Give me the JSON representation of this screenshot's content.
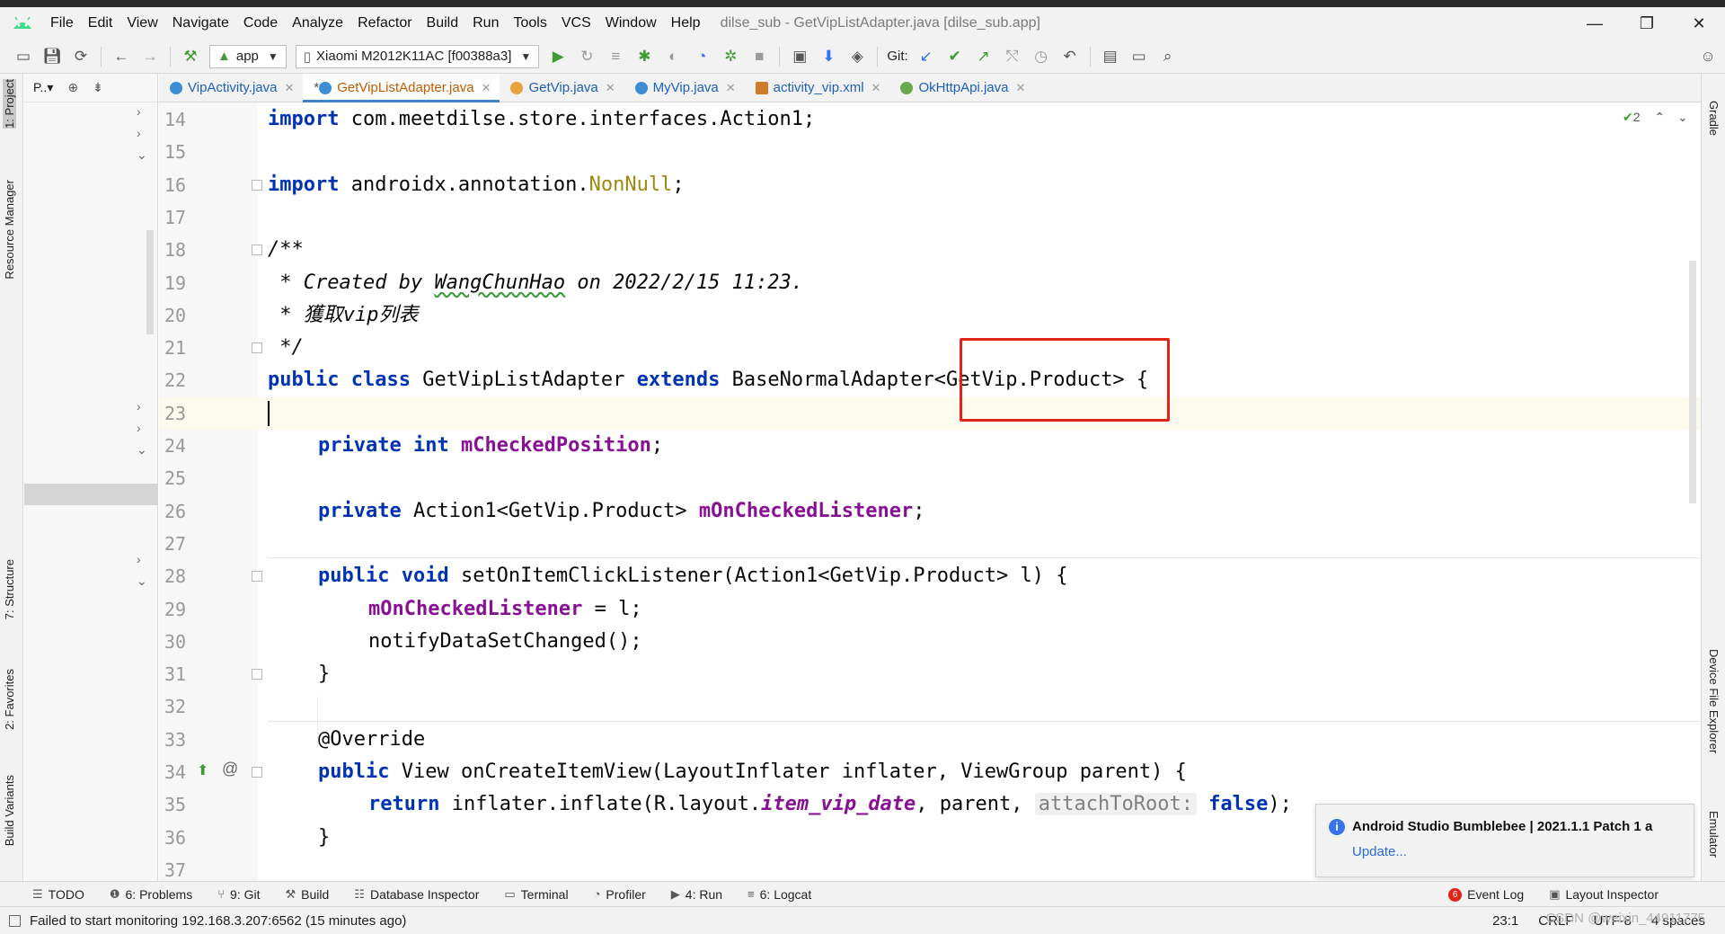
{
  "window": {
    "title": "dilse_sub - GetVipListAdapter.java [dilse_sub.app]",
    "controls": [
      "—",
      "❐",
      "✕"
    ]
  },
  "menu": [
    {
      "label": "File"
    },
    {
      "label": "Edit"
    },
    {
      "label": "View"
    },
    {
      "label": "Navigate"
    },
    {
      "label": "Code"
    },
    {
      "label": "Analyze"
    },
    {
      "label": "Refactor"
    },
    {
      "label": "Build"
    },
    {
      "label": "Run"
    },
    {
      "label": "Tools"
    },
    {
      "label": "VCS"
    },
    {
      "label": "Window"
    },
    {
      "label": "Help"
    }
  ],
  "toolbar": {
    "run_config": "app",
    "device": "Xiaomi M2012K11AC [f00388a3]",
    "git_label": "Git:"
  },
  "left_stripe": {
    "project": "1: Project",
    "resource_manager": "Resource Manager",
    "structure": "7: Structure",
    "favorites": "2: Favorites",
    "build_variants": "Build Variants"
  },
  "right_stripe": {
    "gradle": "Gradle",
    "device_file_explorer": "Device File Explorer",
    "emulator": "Emulator"
  },
  "project_panel": {
    "header": "P..▾"
  },
  "tabs": [
    {
      "label": "VipActivity.java",
      "color": "#3b8ed6"
    },
    {
      "label": "GetVipListAdapter.java",
      "color": "#3b8ed6",
      "modified": "*"
    },
    {
      "label": "GetVip.java",
      "color": "#e8a33d"
    },
    {
      "label": "MyVip.java",
      "color": "#3b8ed6"
    },
    {
      "label": "activity_vip.xml",
      "color": "#d07b2a"
    },
    {
      "label": "OkHttpApi.java",
      "color": "#6aa84f"
    }
  ],
  "editor": {
    "inspection_count": "2",
    "lines": {
      "n14": "14",
      "n15": "15",
      "n16": "16",
      "n17": "17",
      "n18": "18",
      "n19": "19",
      "n20": "20",
      "n21": "21",
      "n22": "22",
      "n23": "23",
      "n24": "24",
      "n25": "25",
      "n26": "26",
      "n27": "27",
      "n28": "28",
      "n29": "29",
      "n30": "30",
      "n31": "31",
      "n32": "32",
      "n33": "33",
      "n34": "34",
      "n35": "35",
      "n36": "36",
      "n37": "37"
    },
    "code": {
      "l14_kw": "import",
      "l14_rest": " com.meetdilse.store.interfaces.Action1;",
      "l16_kw": "import",
      "l16_pkg": " androidx.annotation.",
      "l16_ann": "NonNull",
      "l16_end": ";",
      "l18": "/**",
      "l19_a": " * Created by ",
      "l19_name": "WangChunHao",
      "l19_b": " on 2022/2/15 11:23.",
      "l20": " * 獲取vip列表",
      "l21": " */",
      "l22_kw1": "public class",
      "l22_name": " GetVipListAdapter ",
      "l22_kw2": "extends",
      "l22_rest": " BaseNormalAdapter<GetVip.Product> {",
      "l24_kw": "private int",
      "l24_fld": " mCheckedPosition",
      "l24_end": ";",
      "l26_kw": "private",
      "l26_type": " Action1<GetVip.Product> ",
      "l26_fld": "mOnCheckedListener",
      "l26_end": ";",
      "l28_kw": "public void",
      "l28_rest": " setOnItemClickListener(Action1<GetVip.Product> l) {",
      "l29_fld": "mOnCheckedListener",
      "l29_rest": " = l;",
      "l30": "notifyDataSetChanged();",
      "l31": "}",
      "l33": "@Override",
      "l34_kw": "public",
      "l34_rest": " View onCreateItemView(LayoutInflater inflater, ViewGroup parent) {",
      "l35_kw": "return",
      "l35_a": " inflater.inflate(R.layout.",
      "l35_ital": "item_vip_date",
      "l35_b": ", parent, ",
      "l35_hint": "attachToRoot:",
      "l35_kw2": "false",
      "l35_end": ");",
      "l36": "}"
    }
  },
  "notification": {
    "title": "Android Studio Bumblebee | 2021.1.1 Patch 1 a",
    "link": "Update..."
  },
  "bottom_tools": [
    {
      "label": "TODO"
    },
    {
      "label": "6: Problems"
    },
    {
      "label": "9: Git"
    },
    {
      "label": "Build"
    },
    {
      "label": "Database Inspector"
    },
    {
      "label": "Terminal"
    },
    {
      "label": "Profiler"
    },
    {
      "label": "4: Run"
    },
    {
      "label": "6: Logcat"
    }
  ],
  "bottom_right": {
    "event_log": "Event Log",
    "event_count": "6",
    "layout_inspector": "Layout Inspector"
  },
  "status": {
    "message": "Failed to start monitoring 192.168.3.207:6562 (15 minutes ago)",
    "position": "23:1",
    "line_sep": "CRLF",
    "encoding": "UTF-8",
    "indent": "4 spaces",
    "watermark": "CSDN @weixin_44911775"
  },
  "colors": {
    "keyword": "#0033b3",
    "field": "#871094",
    "annotation": "#9e880d",
    "comment": "#8c8c8c",
    "highlight_box": "#e2231a"
  }
}
